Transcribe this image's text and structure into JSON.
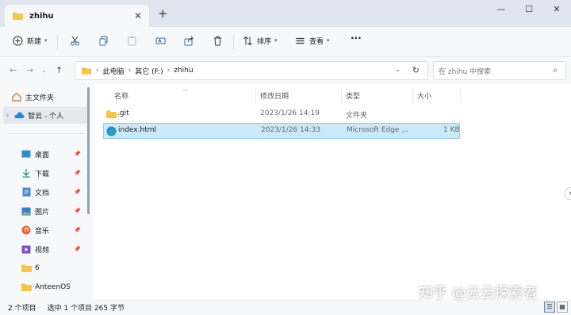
{
  "window": {
    "tab_title": "zhihu",
    "new_tab": "+",
    "tab_close": "✕",
    "minimize": "—",
    "maximize": "☐",
    "close": "✕"
  },
  "toolbar": {
    "new_label": "新建",
    "sort_label": "排序",
    "view_label": "查看",
    "more": "···"
  },
  "address": {
    "crumbs": [
      "此电脑",
      "其它 (F:)",
      "zhihu"
    ],
    "search_placeholder": "在 zhihu 中搜索"
  },
  "sidebar": {
    "items": [
      {
        "label": "主文件夹",
        "icon": "home-icon"
      },
      {
        "label": "智云 - 个人",
        "icon": "cloud-icon"
      },
      {
        "label": "桌面",
        "icon": "desktop-icon",
        "pinned": true
      },
      {
        "label": "下载",
        "icon": "download-icon",
        "pinned": true
      },
      {
        "label": "文档",
        "icon": "document-icon",
        "pinned": true
      },
      {
        "label": "图片",
        "icon": "picture-icon",
        "pinned": true
      },
      {
        "label": "音乐",
        "icon": "music-icon",
        "pinned": true
      },
      {
        "label": "视频",
        "icon": "video-icon",
        "pinned": true
      },
      {
        "label": "6",
        "icon": "folder-icon"
      },
      {
        "label": "AnteenOS",
        "icon": "folder-icon"
      }
    ]
  },
  "columns": {
    "name": "名称",
    "modified": "修改日期",
    "type": "类型",
    "size": "大小"
  },
  "files": [
    {
      "name": ".git",
      "modified": "2023/1/26 14:19",
      "type": "文件夹",
      "size": "",
      "icon": "folder-icon"
    },
    {
      "name": "index.html",
      "modified": "2023/1/26 14:33",
      "type": "Microsoft Edge ...",
      "size": "1 KB",
      "icon": "edge-icon"
    }
  ],
  "status": {
    "count": "2 个项目",
    "selection": "选中 1 个项目  265 字节"
  },
  "watermark": "知乎 @云云探索者",
  "colors": {
    "accent": "#0067c0",
    "folder": "#f4c44e",
    "selection": "#cce8fb"
  }
}
